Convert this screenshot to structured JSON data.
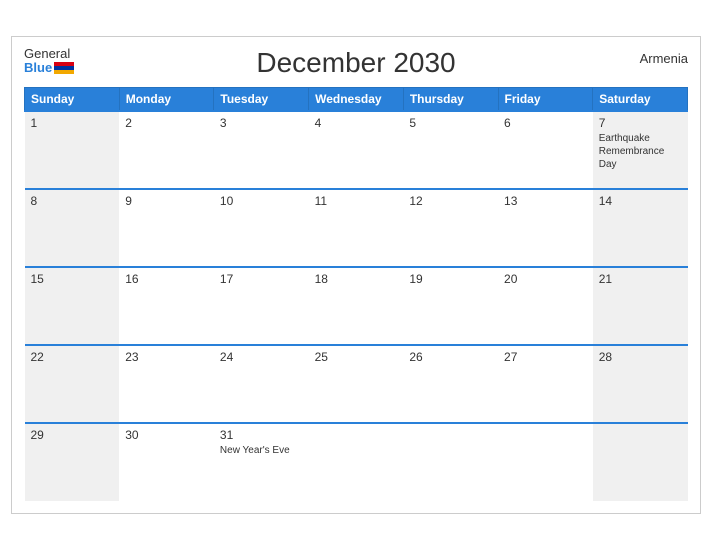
{
  "header": {
    "title": "December 2030",
    "country": "Armenia",
    "logo_general": "General",
    "logo_blue": "Blue"
  },
  "weekdays": [
    "Sunday",
    "Monday",
    "Tuesday",
    "Wednesday",
    "Thursday",
    "Friday",
    "Saturday"
  ],
  "weeks": [
    [
      {
        "day": "1",
        "event": ""
      },
      {
        "day": "2",
        "event": ""
      },
      {
        "day": "3",
        "event": ""
      },
      {
        "day": "4",
        "event": ""
      },
      {
        "day": "5",
        "event": ""
      },
      {
        "day": "6",
        "event": ""
      },
      {
        "day": "7",
        "event": "Earthquake Remembrance Day"
      }
    ],
    [
      {
        "day": "8",
        "event": ""
      },
      {
        "day": "9",
        "event": ""
      },
      {
        "day": "10",
        "event": ""
      },
      {
        "day": "11",
        "event": ""
      },
      {
        "day": "12",
        "event": ""
      },
      {
        "day": "13",
        "event": ""
      },
      {
        "day": "14",
        "event": ""
      }
    ],
    [
      {
        "day": "15",
        "event": ""
      },
      {
        "day": "16",
        "event": ""
      },
      {
        "day": "17",
        "event": ""
      },
      {
        "day": "18",
        "event": ""
      },
      {
        "day": "19",
        "event": ""
      },
      {
        "day": "20",
        "event": ""
      },
      {
        "day": "21",
        "event": ""
      }
    ],
    [
      {
        "day": "22",
        "event": ""
      },
      {
        "day": "23",
        "event": ""
      },
      {
        "day": "24",
        "event": ""
      },
      {
        "day": "25",
        "event": ""
      },
      {
        "day": "26",
        "event": ""
      },
      {
        "day": "27",
        "event": ""
      },
      {
        "day": "28",
        "event": ""
      }
    ],
    [
      {
        "day": "29",
        "event": ""
      },
      {
        "day": "30",
        "event": ""
      },
      {
        "day": "31",
        "event": "New Year's Eve"
      },
      {
        "day": "",
        "event": ""
      },
      {
        "day": "",
        "event": ""
      },
      {
        "day": "",
        "event": ""
      },
      {
        "day": "",
        "event": ""
      }
    ]
  ]
}
